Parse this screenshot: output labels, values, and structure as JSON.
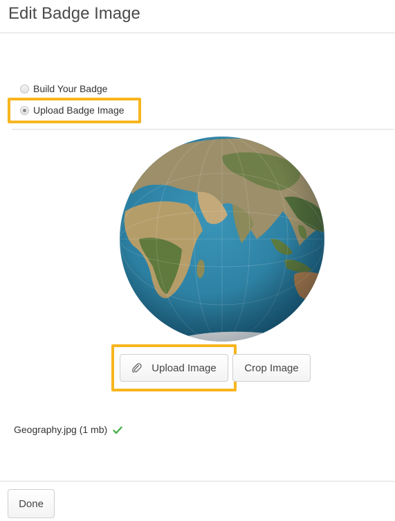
{
  "header": {
    "title": "Edit Badge Image"
  },
  "badge_source": {
    "options": [
      {
        "label": "Build Your Badge",
        "selected": false
      },
      {
        "label": "Upload Badge Image",
        "selected": true
      }
    ]
  },
  "image_actions": {
    "upload_label": "Upload Image",
    "crop_label": "Crop Image"
  },
  "file": {
    "name_size": "Geography.jpg (1 mb)"
  },
  "footer": {
    "done_label": "Done"
  },
  "colors": {
    "highlight": "#f7b51d",
    "ocean": "#2c7fa1",
    "check": "#4cae4c"
  },
  "icons": {
    "attach": "paperclip-icon",
    "status": "checkmark-icon"
  }
}
